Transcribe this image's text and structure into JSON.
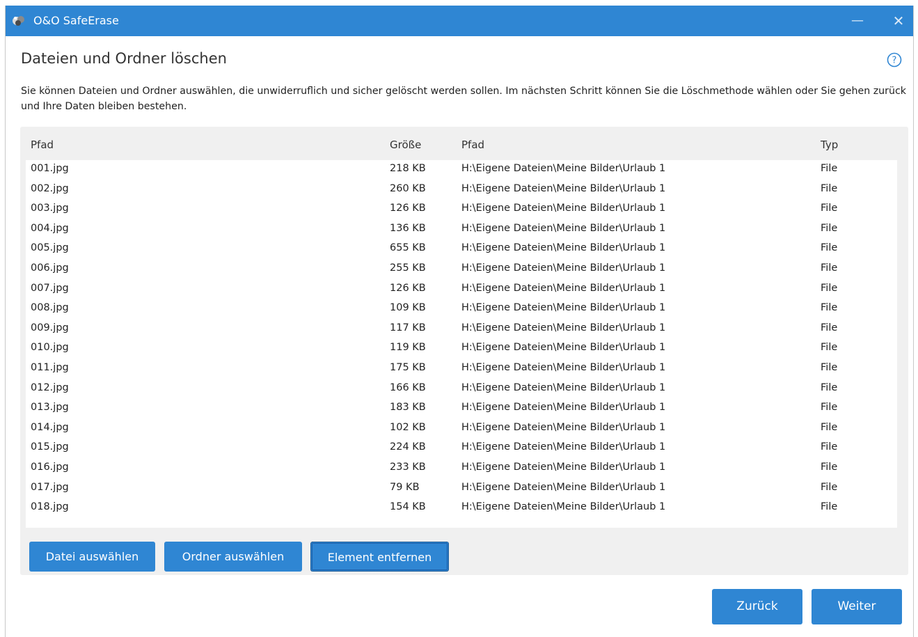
{
  "window": {
    "title": "O&O SafeErase",
    "minimize_glyph": "—",
    "close_glyph": "✕",
    "titlebar_color": "#2f86d3"
  },
  "page": {
    "title": "Dateien und Ordner löschen",
    "help_icon": "question-circle-icon",
    "description": "Sie können Dateien und Ordner auswählen, die unwiderruflich und sicher gelöscht werden sollen.  Im nächsten Schritt können Sie die Löschmethode wählen oder Sie gehen zurück und Ihre Daten bleiben bestehen."
  },
  "table": {
    "headers": {
      "name": "Pfad",
      "size": "Größe",
      "path": "Pfad",
      "type": "Typ"
    },
    "rows": [
      {
        "name": "001.jpg",
        "size": "218 KB",
        "path": "H:\\Eigene Dateien\\Meine Bilder\\Urlaub 1",
        "type": "File"
      },
      {
        "name": "002.jpg",
        "size": "260 KB",
        "path": "H:\\Eigene Dateien\\Meine Bilder\\Urlaub 1",
        "type": "File"
      },
      {
        "name": "003.jpg",
        "size": "126 KB",
        "path": "H:\\Eigene Dateien\\Meine Bilder\\Urlaub 1",
        "type": "File"
      },
      {
        "name": "004.jpg",
        "size": "136 KB",
        "path": "H:\\Eigene Dateien\\Meine Bilder\\Urlaub 1",
        "type": "File"
      },
      {
        "name": "005.jpg",
        "size": "655 KB",
        "path": "H:\\Eigene Dateien\\Meine Bilder\\Urlaub 1",
        "type": "File"
      },
      {
        "name": "006.jpg",
        "size": "255 KB",
        "path": "H:\\Eigene Dateien\\Meine Bilder\\Urlaub 1",
        "type": "File"
      },
      {
        "name": "007.jpg",
        "size": "126 KB",
        "path": "H:\\Eigene Dateien\\Meine Bilder\\Urlaub 1",
        "type": "File"
      },
      {
        "name": "008.jpg",
        "size": "109 KB",
        "path": "H:\\Eigene Dateien\\Meine Bilder\\Urlaub 1",
        "type": "File"
      },
      {
        "name": "009.jpg",
        "size": "117 KB",
        "path": "H:\\Eigene Dateien\\Meine Bilder\\Urlaub 1",
        "type": "File"
      },
      {
        "name": "010.jpg",
        "size": "119 KB",
        "path": "H:\\Eigene Dateien\\Meine Bilder\\Urlaub 1",
        "type": "File"
      },
      {
        "name": "011.jpg",
        "size": "175 KB",
        "path": "H:\\Eigene Dateien\\Meine Bilder\\Urlaub 1",
        "type": "File"
      },
      {
        "name": "012.jpg",
        "size": "166 KB",
        "path": "H:\\Eigene Dateien\\Meine Bilder\\Urlaub 1",
        "type": "File"
      },
      {
        "name": "013.jpg",
        "size": "183 KB",
        "path": "H:\\Eigene Dateien\\Meine Bilder\\Urlaub 1",
        "type": "File"
      },
      {
        "name": "014.jpg",
        "size": "102 KB",
        "path": "H:\\Eigene Dateien\\Meine Bilder\\Urlaub 1",
        "type": "File"
      },
      {
        "name": "015.jpg",
        "size": "224 KB",
        "path": "H:\\Eigene Dateien\\Meine Bilder\\Urlaub 1",
        "type": "File"
      },
      {
        "name": "016.jpg",
        "size": "233 KB",
        "path": "H:\\Eigene Dateien\\Meine Bilder\\Urlaub 1",
        "type": "File"
      },
      {
        "name": "017.jpg",
        "size": "79 KB",
        "path": "H:\\Eigene Dateien\\Meine Bilder\\Urlaub 1",
        "type": "File"
      },
      {
        "name": "018.jpg",
        "size": "154 KB",
        "path": "H:\\Eigene Dateien\\Meine Bilder\\Urlaub 1",
        "type": "File"
      }
    ]
  },
  "actions": {
    "select_file": "Datei auswählen",
    "select_folder": "Ordner auswählen",
    "remove_item": "Element entfernen"
  },
  "navigation": {
    "back": "Zurück",
    "next": "Weiter"
  },
  "colors": {
    "accent": "#2f86d3",
    "panel": "#f0f0f0"
  }
}
